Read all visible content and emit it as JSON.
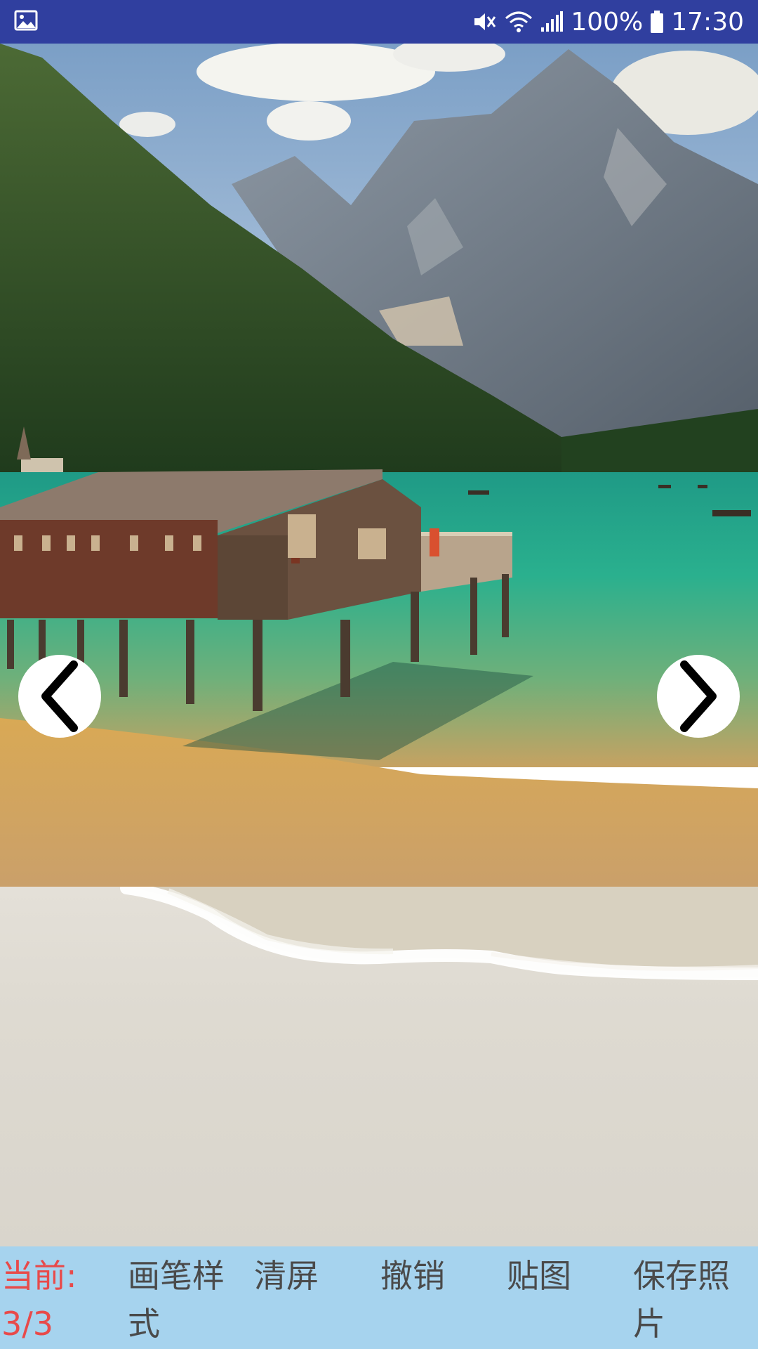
{
  "status_bar": {
    "battery": "100%",
    "time": "17:30",
    "icons": [
      "gallery-icon",
      "mute-icon",
      "wifi-icon",
      "signal-icon",
      "battery-icon"
    ]
  },
  "navigation": {
    "prev_icon": "chevron-left-icon",
    "next_icon": "chevron-right-icon"
  },
  "toolbar": {
    "current_label": "当前:",
    "current_value": "3/3",
    "items": [
      {
        "label": "画笔样式"
      },
      {
        "label": "清屏"
      },
      {
        "label": "撤销"
      },
      {
        "label": "贴图"
      },
      {
        "label": "保存照片"
      }
    ]
  },
  "colors": {
    "status_bar": "#303f9f",
    "toolbar": "#a6d3ee",
    "current_text": "#e84a4a",
    "toolbar_text": "#4a4a4a"
  }
}
